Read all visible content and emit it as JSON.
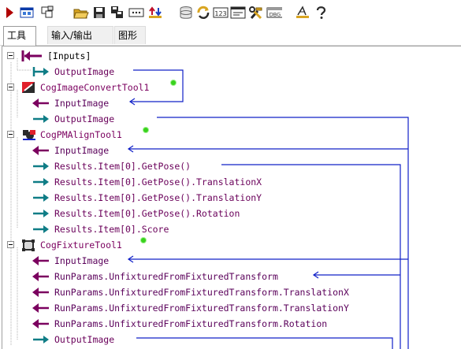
{
  "toolbar": {
    "buttons": [
      {
        "icon": "run-triangle-icon",
        "color": "#b00000"
      },
      {
        "icon": "display-window-icon",
        "color": "#0b3aa8"
      },
      {
        "icon": "copy-tool-icon",
        "color": "#2a2a2a"
      },
      {
        "icon": "open-folder-icon",
        "color": "#d9a521"
      },
      {
        "icon": "save-disk-icon",
        "color": "#2a2a2a"
      },
      {
        "icon": "save-as-icon",
        "color": "#2a2a2a"
      },
      {
        "icon": "terminal-dots-icon",
        "color": "#2a2a2a"
      },
      {
        "icon": "import-export-icon",
        "color": "#c0102a"
      },
      {
        "icon": "database-icon",
        "color": "#6a6a6a"
      },
      {
        "icon": "refresh-arrows-icon",
        "color": "#d9a521"
      },
      {
        "icon": "number-123-icon",
        "color": "#2a2a2a"
      },
      {
        "icon": "form-icon",
        "color": "#2a2a2a"
      },
      {
        "icon": "tools-icon",
        "color": "#d9a521"
      },
      {
        "icon": "dbg-icon",
        "color": "#2a2a2a"
      },
      {
        "icon": "line-tool-icon",
        "color": "#2a2a2a"
      },
      {
        "icon": "help-question-icon",
        "color": "#2a2a2a"
      }
    ],
    "labels": {
      "number": "123",
      "dbg": "DBG"
    }
  },
  "tabs": [
    {
      "label": "工具",
      "active": true
    },
    {
      "label": "输入/输出",
      "active": false
    },
    {
      "label": "图形",
      "active": false
    }
  ],
  "colors": {
    "wire": "#1020c8",
    "output_arrow": "#0f7d86",
    "input_arrow": "#7b005f",
    "label_text": "#5c005c",
    "ok_dot": "#3bd420"
  },
  "tree": {
    "inputs_group": {
      "label": "[Inputs]",
      "output": "OutputImage"
    },
    "tools": [
      {
        "name": "CogImageConvertTool1",
        "status": "ok",
        "terminals": [
          {
            "dir": "in",
            "label": "InputImage"
          },
          {
            "dir": "out",
            "label": "OutputImage"
          }
        ]
      },
      {
        "name": "CogPMAlignTool1",
        "status": "ok",
        "terminals": [
          {
            "dir": "in",
            "label": "InputImage"
          },
          {
            "dir": "out",
            "label": "Results.Item[0].GetPose()"
          },
          {
            "dir": "out",
            "label": "Results.Item[0].GetPose().TranslationX"
          },
          {
            "dir": "out",
            "label": "Results.Item[0].GetPose().TranslationY"
          },
          {
            "dir": "out",
            "label": "Results.Item[0].GetPose().Rotation"
          },
          {
            "dir": "out",
            "label": "Results.Item[0].Score"
          }
        ]
      },
      {
        "name": "CogFixtureTool1",
        "status": "ok",
        "terminals": [
          {
            "dir": "in",
            "label": "InputImage"
          },
          {
            "dir": "in",
            "label": "RunParams.UnfixturedFromFixturedTransform"
          },
          {
            "dir": "in",
            "label": "RunParams.UnfixturedFromFixturedTransform.TranslationX"
          },
          {
            "dir": "in",
            "label": "RunParams.UnfixturedFromFixturedTransform.TranslationY"
          },
          {
            "dir": "in",
            "label": "RunParams.UnfixturedFromFixturedTransform.Rotation"
          },
          {
            "dir": "out",
            "label": "OutputImage"
          }
        ]
      }
    ]
  }
}
